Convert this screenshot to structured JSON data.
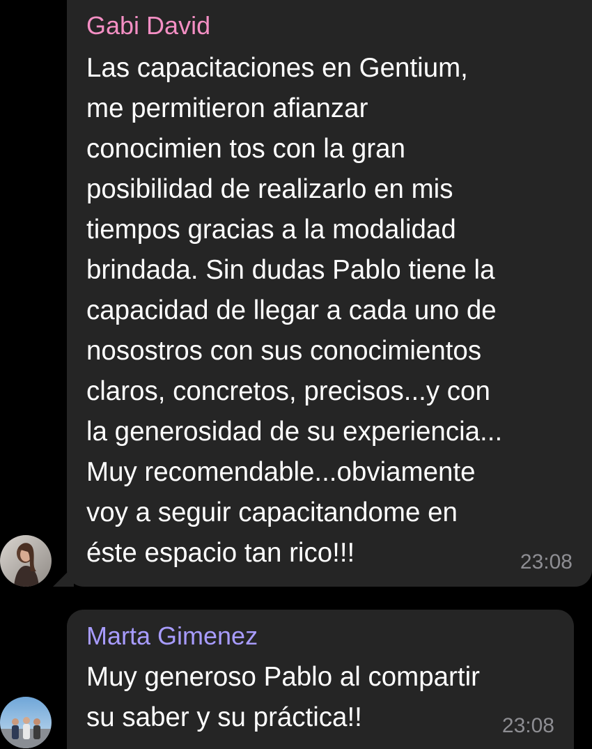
{
  "messages": [
    {
      "sender": "Gabi David",
      "sender_color": "#f48fc4",
      "text": "Las capacitaciones en Gentium,\nme permitieron afianzar\nconocimien tos con la gran\nposibilidad de realizarlo en mis\ntiempos gracias a la modalidad\nbrindada. Sin dudas Pablo tiene la\ncapacidad de llegar a cada uno de\nnosostros con sus conocimientos\nclaros, concretos, precisos...y con\nla generosidad de su experiencia...\nMuy recomendable...obviamente\nvoy a seguir capacitandome en\néste espacio tan rico!!!",
      "time": "23:08",
      "avatar_icon": "user-avatar-photo-icon"
    },
    {
      "sender": "Marta Gimenez",
      "sender_color": "#a89cff",
      "text": "Muy generoso Pablo al compartir\nsu saber y su práctica!!",
      "time": "23:08",
      "avatar_icon": "group-avatar-photo-icon"
    }
  ],
  "colors": {
    "background": "#000000",
    "bubble": "#252525",
    "message_text": "#ffffff",
    "timestamp": "#8e8e93"
  }
}
